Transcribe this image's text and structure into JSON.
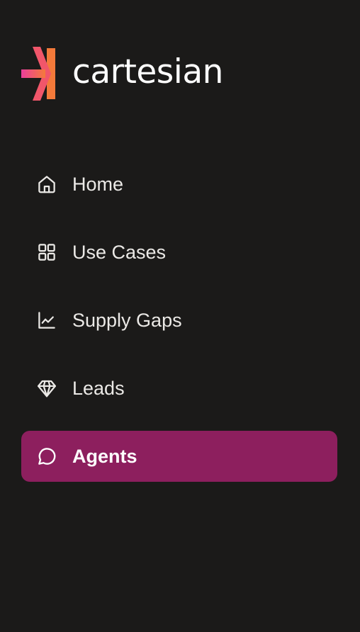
{
  "brand": {
    "name": "cartesian",
    "logo_icon": "cartesian-logo-icon",
    "colors": {
      "magenta": "#ec3e9b",
      "orange": "#f47a3a",
      "mid": "#f1566a"
    }
  },
  "nav": {
    "items": [
      {
        "label": "Home",
        "icon": "home-icon",
        "active": false
      },
      {
        "label": "Use Cases",
        "icon": "grid-icon",
        "active": false
      },
      {
        "label": "Supply Gaps",
        "icon": "chart-line-icon",
        "active": false
      },
      {
        "label": "Leads",
        "icon": "diamond-icon",
        "active": false
      },
      {
        "label": "Agents",
        "icon": "chat-bubble-icon",
        "active": true
      }
    ]
  },
  "theme": {
    "background": "#1b1a19",
    "active_background": "#8d1f5e",
    "text": "#ebe9e6"
  }
}
